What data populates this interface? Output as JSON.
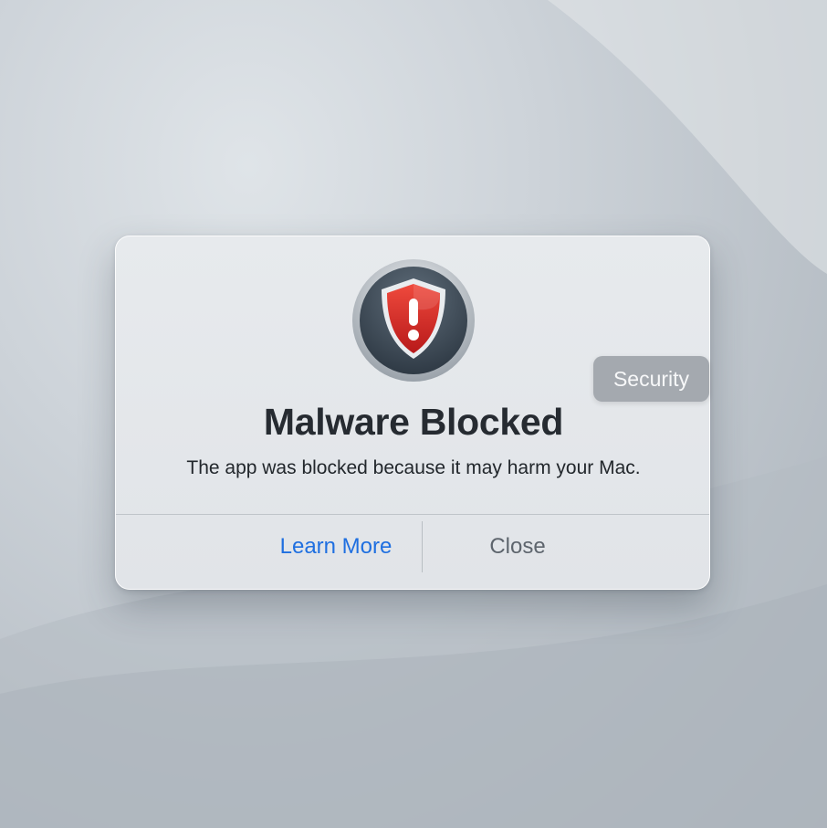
{
  "dialog": {
    "title": "Malware Blocked",
    "message": "The app was blocked because it may harm your Mac.",
    "tag_label": "Security",
    "icon": "shield-warning-icon",
    "buttons": {
      "learn_more": "Learn More",
      "close": "Close"
    }
  },
  "colors": {
    "accent": "#1f6fe0",
    "shield_red": "#d42a24",
    "badge_dark": "#3d4a56"
  }
}
